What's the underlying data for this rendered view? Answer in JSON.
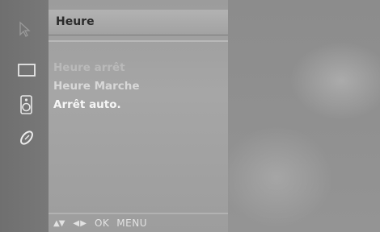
{
  "menu": {
    "title": "Heure",
    "items": [
      {
        "label": "Heure arrêt"
      },
      {
        "label": "Heure Marche"
      },
      {
        "label": "Arrêt auto."
      }
    ]
  },
  "footer": {
    "updown_glyph": "▲▼",
    "leftright_glyph": "◀ ▶",
    "ok_label": "OK",
    "menu_label": "MENU"
  },
  "sidebar": {
    "icons": [
      "cursor-icon",
      "screen-icon",
      "speaker-icon",
      "clock-icon"
    ]
  }
}
